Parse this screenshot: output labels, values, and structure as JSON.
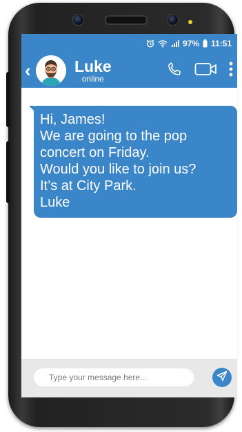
{
  "status_bar": {
    "battery_percent": "97%",
    "time": "11:51",
    "icons": [
      "alarm-icon",
      "wifi-icon",
      "signal-icon",
      "battery-icon"
    ]
  },
  "header": {
    "back_label": "‹",
    "contact_name": "Luke",
    "contact_status": "online",
    "icons": [
      "back-icon",
      "avatar",
      "phone-icon",
      "video-icon",
      "more-icon"
    ]
  },
  "messages": [
    {
      "lines": [
        "Hi, James!",
        "We are going to the pop",
        "concert on Friday.",
        "Would you like to join us?",
        "It’s at City Park.",
        "Luke"
      ]
    }
  ],
  "composer": {
    "placeholder": "Type your message here...",
    "value": "",
    "send_icon": "send-icon"
  },
  "colors": {
    "accent": "#3b86c9",
    "composer_bg": "#e8e8e8",
    "frame": "#2a2a2a"
  }
}
